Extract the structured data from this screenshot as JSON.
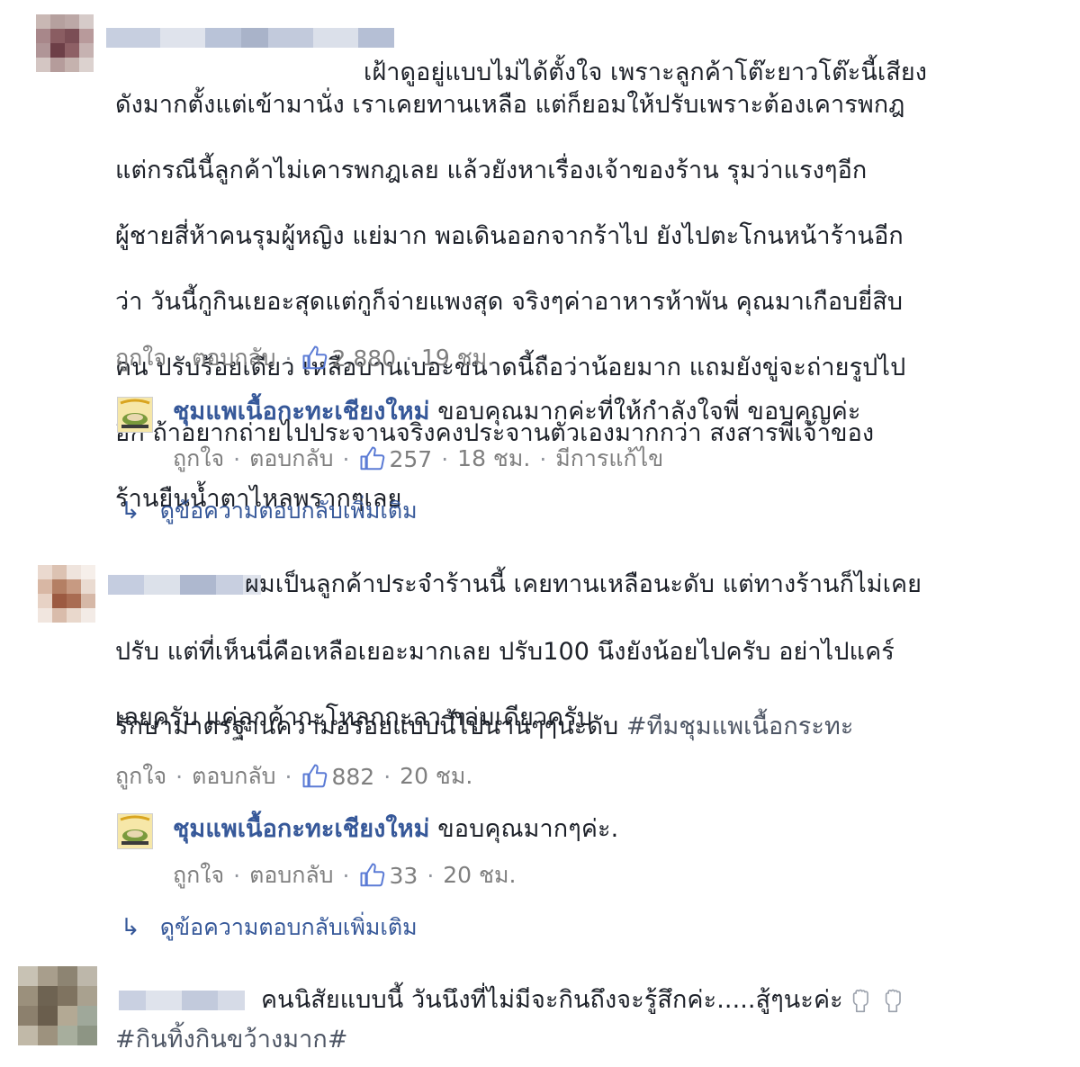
{
  "comments": [
    {
      "text": "เฝ้าดูอยู่แบบไม่ได้ตั้งใจ เพราะลูกค้าโต๊ะยาวโต๊ะนี้เสียงดังมากตั้งแต่เข้ามานั่ง เราเคยทานเหลือ แต่ก็ยอมให้ปรับเพราะต้องเคารพกฎ แต่กรณีนี้ลูกค้าไม่เคารพกฎเลย แล้วยังหาเรื่องเจ้าของร้าน รุมว่าแรงๆอีก ผู้ชายสี่ห้าคนรุมผู้หญิง แย่มาก พอเดินออกจากร้าไป ยังไปตะโกนหน้าร้านอีกว่า วันนี้กูกินเยอะสุดแต่กูก็จ่ายแพงสุด จริงๆค่าอาหารห้าพัน คุณมาเกือบยี่สิบคน ปรับร้อยเดียว เหลือบานเบอะขนาดนี้ถือว่าน้อยมาก แถมยังขู่จะถ่ายรูปไปอีก ถ้าอยากถ่ายไปประจานจริงคงประจานตัวเองมากกว่า สงสารพี่เจ้าของร้านยืนน้ำตาไหลพรากๆเลย",
      "lines": [
        "เฝ้าดูอยู่แบบไม่ได้ตั้งใจ เพราะลูกค้าโต๊ะยาวโต๊ะนี้เสียง",
        "ดังมากตั้งแต่เข้ามานั่ง เราเคยทานเหลือ แต่ก็ยอมให้ปรับเพราะต้องเคารพกฎ",
        "แต่กรณีนี้ลูกค้าไม่เคารพกฎเลย แล้วยังหาเรื่องเจ้าของร้าน รุมว่าแรงๆอีก",
        "ผู้ชายสี่ห้าคนรุมผู้หญิง แย่มาก พอเดินออกจากร้าไป ยังไปตะโกนหน้าร้านอีก",
        "ว่า วันนี้กูกินเยอะสุดแต่กูก็จ่ายแพงสุด จริงๆค่าอาหารห้าพัน คุณมาเกือบยี่สิบ",
        "คน ปรับร้อยเดียว เหลือบานเบอะขนาดนี้ถือว่าน้อยมาก แถมยังขู่จะถ่ายรูปไป",
        "อีก ถ้าอยากถ่ายไปประจานจริงคงประจานตัวเองมากกว่า สงสารพี่เจ้าของ",
        "ร้านยืนน้ำตาไหลพรากๆเลย"
      ],
      "like_label": "ถูกใจ",
      "reply_label": "ตอบกลับ",
      "like_count": "2,880",
      "time": "19 ชม.",
      "reply": {
        "author": "ชุมแพเนื้อกะทะเชียงใหม่",
        "text": "ขอบคุณมากค่ะที่ให้กำลังใจพี่ ขอบคุญค่ะ",
        "like_label": "ถูกใจ",
        "reply_label": "ตอบกลับ",
        "like_count": "257",
        "time": "18 ชม.",
        "edited": "มีการแก้ไข"
      },
      "more_replies": "ดูข้อความตอบกลับเพิ่มเติม"
    },
    {
      "lines": [
        "ผมเป็นลูกค้าประจำร้านนี้ เคยทานเหลือนะดับ แต่ทางร้านก็ไม่เคย",
        "ปรับ แต่ที่เห็นนี่คือเหลือเยอะมากเลย ปรับ100 นึงยังน้อยไปครับ อย่าไปแคร์",
        "เลยครับ แค่ลูกค้ากะโหลกกะลา กลุ่มเดียวครับ"
      ],
      "line2_prefix": "รักษามาตรฐานความอร่อยแบบนี้ไปนานๆๆนะดับ ",
      "hashtag": "#ทีมชุมแพเนื้อกระทะ",
      "like_label": "ถูกใจ",
      "reply_label": "ตอบกลับ",
      "like_count": "882",
      "time": "20 ชม.",
      "reply": {
        "author": "ชุมแพเนื้อกะทะเชียงใหม่",
        "text": "ขอบคุณมากๆค่ะ.",
        "like_label": "ถูกใจ",
        "reply_label": "ตอบกลับ",
        "like_count": "33",
        "time": "20 ชม."
      },
      "more_replies": "ดูข้อความตอบกลับเพิ่มเติม"
    },
    {
      "text": "คนนิสัยแบบนี้ วันนึงที่ไม่มีจะกินถึงจะรู้สึกค่ะ.....สู้ๆนะค่ะ",
      "hashtag": "#กินทิ้งกินขว้างมาก#"
    }
  ],
  "colors": {
    "text": "#1d2129",
    "page_name": "#365899",
    "meta": "#90949c",
    "link": "#365899"
  },
  "icons": {
    "like": "thumbs-up-icon",
    "reply_arrow": "reply-arrow-icon",
    "emoji": "fist-emoji-icon"
  }
}
